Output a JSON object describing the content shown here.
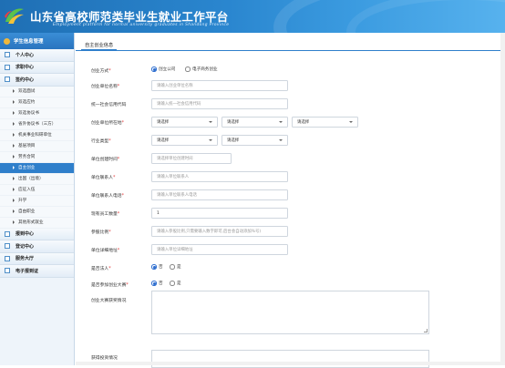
{
  "header": {
    "title": "山东省高校师范类毕业生就业工作平台",
    "subtitle": "Employment platform for normal university graduates in Shandong Province"
  },
  "sidebar": {
    "head": "学生信息管理",
    "sections_top": [
      "个人中心",
      "求职中心",
      "签约中心"
    ],
    "items": [
      "双选面试",
      "双选应约",
      "双选协议书",
      "省外协议书（三方）",
      "机关事业科研单位",
      "基层项目",
      "劳务合同",
      "自主创业",
      "出国（出境）",
      "应征入伍",
      "升学",
      "自由职业",
      "其他形式就业"
    ],
    "active_item": "自主创业",
    "sections_bottom": [
      "报到中心",
      "登记中心",
      "服务大厅",
      "电子报到证"
    ]
  },
  "tab": "自主创业信息",
  "form": {
    "mode": {
      "label": "创业方式",
      "opt1": "创立公司",
      "opt2": "电子商务创业"
    },
    "company": {
      "label": "创业单位名称",
      "placeholder": "请输入创业单位名称"
    },
    "credit": {
      "label": "统一社会信用代码",
      "placeholder": "请输入统一社会信用代码"
    },
    "location": {
      "label": "创业单位所在地",
      "sel1": "请选择",
      "sel2": "请选择",
      "sel3": "请选择"
    },
    "industry": {
      "label": "行业类型",
      "sel1": "请选择",
      "sel2": "请选择"
    },
    "regtime": {
      "label": "单位创建时间",
      "placeholder": "请选择单位创建时间"
    },
    "contact": {
      "label": "单位联系人",
      "placeholder": "请输入单位联系人"
    },
    "phone": {
      "label": "单位联系人电话",
      "placeholder": "请输入单位联系人电话"
    },
    "staff": {
      "label": "现有员工数量",
      "value": "1"
    },
    "ratio": {
      "label": "参股比例",
      "placeholder": "请输入参股比例,只需要输入数字即可,后台会自动添加%号)"
    },
    "address": {
      "label": "单位详细地址",
      "placeholder": "请输入单位详细地址"
    },
    "legal": {
      "label": "是否法人",
      "opt1": "否",
      "opt2": "是"
    },
    "contest": {
      "label": "是否参加创业大赛",
      "opt1": "否",
      "opt2": "是"
    },
    "award": {
      "label": "创业大赛获奖情况"
    },
    "invest": {
      "label": "获得投资情况"
    }
  }
}
